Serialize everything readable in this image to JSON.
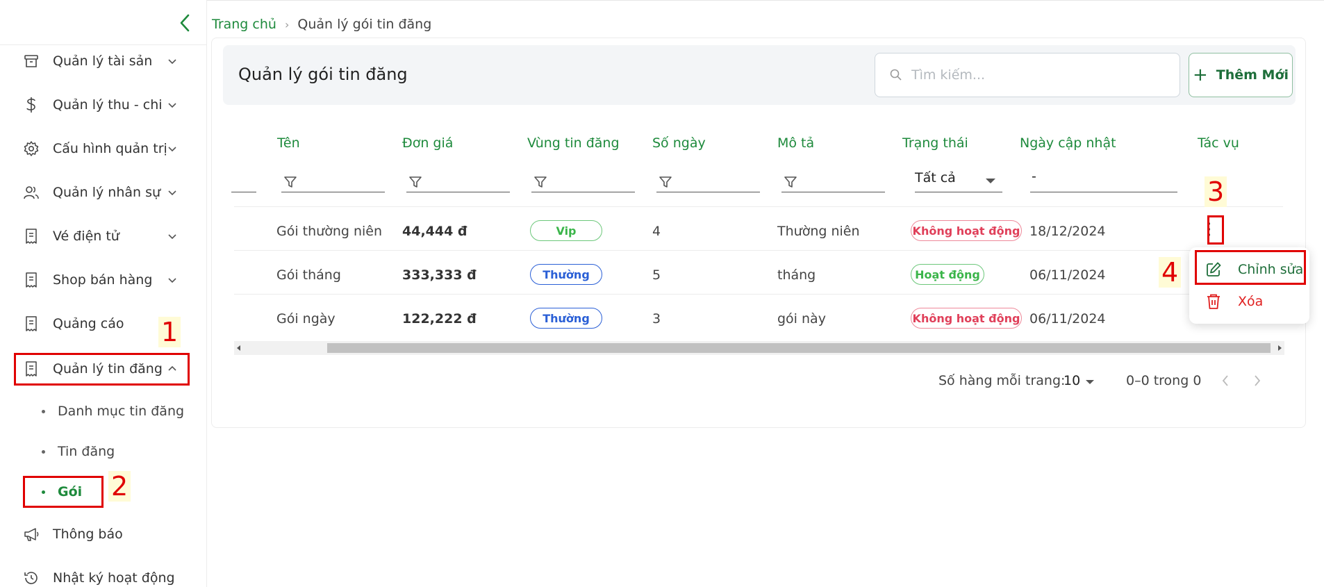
{
  "sidebar": {
    "collapse_icon": "chevron-left-icon",
    "items": [
      {
        "label": "Quản lý tài sản",
        "icon": "archive-icon"
      },
      {
        "label": "Quản lý thu - chi",
        "icon": "dollar-icon"
      },
      {
        "label": "Cấu hình quản trị",
        "icon": "gear-icon"
      },
      {
        "label": "Quản lý nhân sự",
        "icon": "users-icon"
      },
      {
        "label": "Vé điện tử",
        "icon": "receipt-icon"
      },
      {
        "label": "Shop bán hàng",
        "icon": "receipt-icon"
      },
      {
        "label": "Quảng cáo",
        "icon": "receipt-icon"
      },
      {
        "label": "Quản lý tin đăng",
        "icon": "receipt-icon"
      },
      {
        "label": "Thông báo",
        "icon": "megaphone-icon"
      },
      {
        "label": "Nhật ký hoạt động",
        "icon": "history-icon"
      }
    ],
    "submenu": [
      {
        "label": "Danh mục tin đăng"
      },
      {
        "label": "Tin đăng"
      },
      {
        "label": "Gói",
        "active": true
      }
    ]
  },
  "breadcrumb": {
    "home": "Trang chủ",
    "separator": "›",
    "current": "Quản lý gói tin đăng"
  },
  "header": {
    "title": "Quản lý gói tin đăng",
    "search_placeholder": "Tìm kiếm...",
    "add_label": "Thêm Mới"
  },
  "table": {
    "columns": [
      "Tên",
      "Đơn giá",
      "Vùng tin đăng",
      "Số ngày",
      "Mô tả",
      "Trạng thái",
      "Ngày cập nhật",
      "Tác vụ"
    ],
    "filters": {
      "status_value": "Tất cả",
      "date_value": "-"
    },
    "rows": [
      {
        "name": "Gói thường niên",
        "price": "44,444 đ",
        "region": "Vip",
        "days": "4",
        "desc": "Thường niên",
        "status": "Không hoạt động",
        "updated": "18/12/2024"
      },
      {
        "name": "Gói tháng",
        "price": "333,333 đ",
        "region": "Thường",
        "days": "5",
        "desc": "tháng",
        "status": "Hoạt động",
        "updated": "06/11/2024"
      },
      {
        "name": "Gói ngày",
        "price": "122,222 đ",
        "region": "Thường",
        "days": "3",
        "desc": "gói này",
        "status": "Không hoạt động",
        "updated": "06/11/2024"
      }
    ]
  },
  "pagination": {
    "rows_per_page_label": "Số hàng mỗi trang:",
    "rows_per_page": "10",
    "range": "0–0 trong 0"
  },
  "action_menu": {
    "edit_label": "Chỉnh sửa",
    "delete_label": "Xóa"
  },
  "annotations": [
    "1",
    "2",
    "3",
    "4"
  ],
  "colors": {
    "primary_green": "#1e8a3c",
    "annotation_red": "#e00000",
    "status_inactive": "#e0405a",
    "status_active": "#3bb54a",
    "region_normal": "#2a5fd6"
  }
}
